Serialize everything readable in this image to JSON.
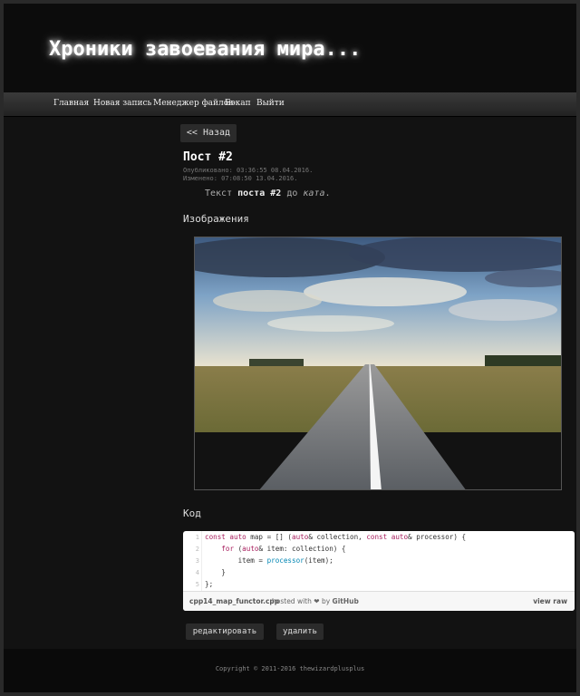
{
  "site": {
    "title": "Хроники завоевания мира..."
  },
  "nav": {
    "items": [
      {
        "label": "Главная"
      },
      {
        "label": "Новая запись"
      },
      {
        "label": "Менеджер файлов"
      },
      {
        "label": "Бэкап"
      },
      {
        "label": "Выйти"
      }
    ]
  },
  "post": {
    "back_label": "<< Назад",
    "title": "Пост #2",
    "published": "Опубликовано: 03:36:55 08.04.2016.",
    "modified": "Изменено: 07:08:50 13.04.2016.",
    "text_before": "Текст ",
    "text_bold": "поста #2",
    "text_middle": " до ",
    "text_italic": "ката",
    "text_after": "."
  },
  "images_heading": "Изображения",
  "code_heading": "Код",
  "gist": {
    "line_numbers": [
      "1",
      "2",
      "3",
      "4",
      "5"
    ],
    "line1": {
      "k1": "const auto",
      "t1": " map = [] (",
      "k2": "auto",
      "t2": "& collection, ",
      "k3": "const auto",
      "t3": "& processor) {"
    },
    "line2": {
      "t0": "    ",
      "k1": "for",
      "t1": " (",
      "k2": "auto",
      "t2": "& item: collection) {"
    },
    "line3": {
      "t0": "        item = ",
      "f1": "processor",
      "t1": "(item);"
    },
    "line4": "    }",
    "line5": "};",
    "filename": "cpp14_map_functor.cpp",
    "hosted_with": "hosted with",
    "heart": "❤",
    "by": "by",
    "github": "GitHub",
    "view_raw": "view raw"
  },
  "actions": {
    "edit_label": "редактировать",
    "delete_label": "удалить"
  },
  "footer": {
    "copyright": "Copyright © 2011-2016 thewizardplusplus"
  }
}
